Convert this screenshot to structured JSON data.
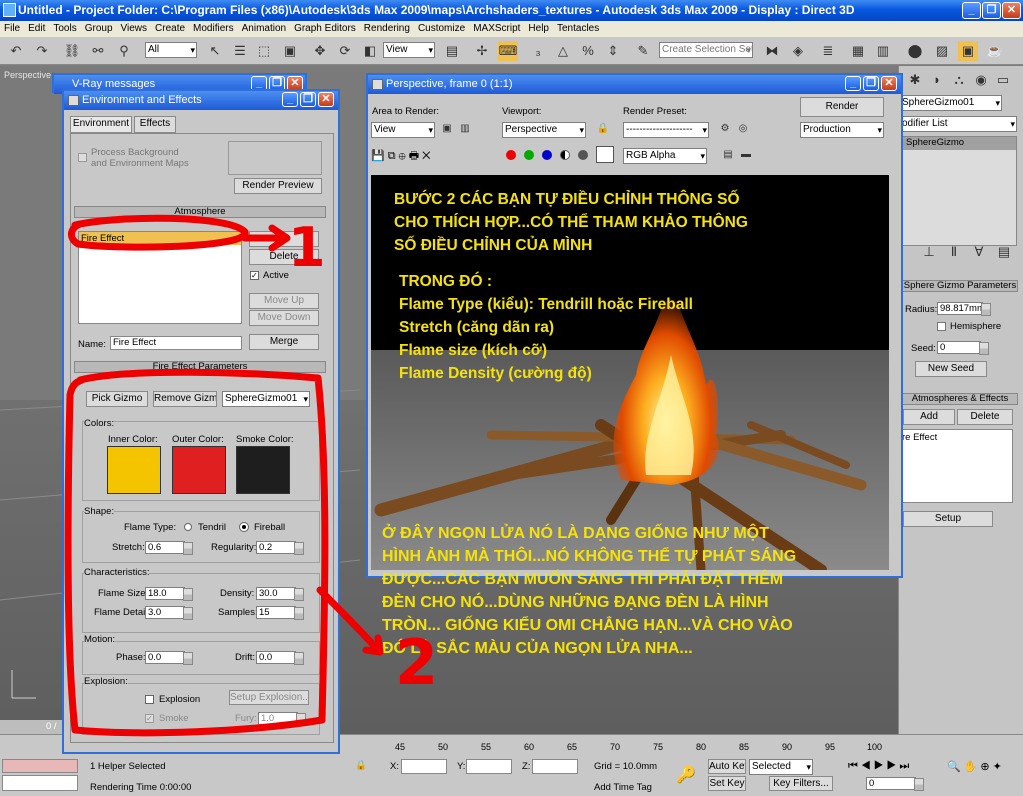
{
  "app": {
    "title": "Untitled    - Project Folder: C:\\Program Files (x86)\\Autodesk\\3ds Max 2009\\maps\\Archshaders_textures      - Autodesk 3ds Max  2009      - Display : Direct 3D"
  },
  "menu": [
    "File",
    "Edit",
    "Tools",
    "Group",
    "Views",
    "Create",
    "Modifiers",
    "Animation",
    "Graph Editors",
    "Rendering",
    "Customize",
    "MAXScript",
    "Help",
    "Tentacles"
  ],
  "toolbar": {
    "filter": "All",
    "view": "View",
    "selection_set": "Create Selection Set"
  },
  "viewport": {
    "label": "Perspective"
  },
  "vray": {
    "title": "V-Ray messages"
  },
  "env": {
    "title": "Environment and Effects",
    "tabs": [
      "Environment",
      "Effects"
    ],
    "process_bg": "Process Background",
    "process_env": "and Environment Maps",
    "render_preview": "Render Preview",
    "atmosphere_header": "Atmosphere",
    "list_item": "Fire Effect",
    "delete": "Delete",
    "active": "Active",
    "move_up": "Move Up",
    "move_down": "Move Down",
    "name_label": "Name:",
    "name_value": "Fire Effect",
    "merge": "Merge",
    "params_header": "Fire Effect Parameters",
    "pick_gizmo": "Pick Gizmo",
    "remove_gizmo": "Remove Gizmo",
    "gizmo_select": "SphereGizmo01",
    "colors_label": "Colors:",
    "inner_color": "Inner Color:",
    "outer_color": "Outer Color:",
    "smoke_color": "Smoke Color:",
    "shape_label": "Shape:",
    "flame_type": "Flame Type:",
    "tendril": "Tendril",
    "fireball": "Fireball",
    "stretch": "Stretch:",
    "stretch_val": "0.6",
    "regularity": "Regularity:",
    "regularity_val": "0.2",
    "characteristics": "Characteristics:",
    "flame_size": "Flame Size:",
    "flame_size_val": "18.0",
    "density": "Density:",
    "density_val": "30.0",
    "flame_detail": "Flame Detail:",
    "flame_detail_val": "3.0",
    "samples": "Samples:",
    "samples_val": "15",
    "motion": "Motion:",
    "phase": "Phase:",
    "phase_val": "0.0",
    "drift": "Drift:",
    "drift_val": "0.0",
    "explosion_label": "Explosion:",
    "explosion": "Explosion",
    "setup_explosion": "Setup Explosion...",
    "smoke": "Smoke",
    "fury": "Fury:",
    "fury_val": "1.0"
  },
  "colors": {
    "inner": "#f5c400",
    "outer": "#e02020",
    "smoke": "#1e1e1e"
  },
  "frame": {
    "title": "Perspective, frame 0 (1:1)",
    "area_label": "Area to Render:",
    "area_value": "View",
    "viewport_label": "Viewport:",
    "viewport_value": "Perspective",
    "preset_label": "Render Preset:",
    "preset_value": "--------------------",
    "render": "Render",
    "production": "Production",
    "channel": "RGB Alpha"
  },
  "annotation": {
    "top": [
      "BƯỚC 2 CÁC BẠN TỰ ĐIỀU CHỈNH THÔNG SỐ",
      "CHO THÍCH HỢP...CÓ THỂ THAM KHẢO THÔNG",
      "SỐ ĐIỀU CHỈNH CỦA MÌNH"
    ],
    "list": [
      "TRONG ĐÓ :",
      "Flame Type (kiểu): Tendrill hoặc Fireball",
      "Stretch (căng dãn ra)",
      "Flame size (kích cỡ)",
      "Flame Density (cường độ)"
    ],
    "bottom": [
      "Ở ĐÂY NGỌN LỬA NÓ LÀ DẠNG GIỐNG NHƯ MỘT",
      "HÌNH ẢNH MÀ THÔI...NÓ KHÔNG THỂ TỰ PHÁT SÁNG",
      "ĐƯỢC...CÁC BẠN MUỐN SÁNG THÌ PHẢI ĐẶT THÊM",
      "ĐÈN CHO NÓ...DÙNG NHỮNG ĐẠNG ĐÈN LÀ HÌNH",
      "TRÒN... GIỐNG KIỂU OMI CHẲNG HẠN...VÀ CHO VÀO",
      "ĐÓ LÀ SẮC MÀU CỦA NGỌN LỬA NHA..."
    ],
    "mark1": "1",
    "mark2": "2"
  },
  "cmd": {
    "object": "SphereGizmo01",
    "modifier_list": "odifier List",
    "stack_item": "SphereGizmo",
    "gizmo_params": "Sphere Gizmo Parameters",
    "radius": "Radius:",
    "radius_val": "98.817mm",
    "hemisphere": "Hemisphere",
    "seed": "Seed:",
    "seed_val": "0",
    "new_seed": "New Seed",
    "atmos": "Atmospheres & Effects",
    "add": "Add",
    "delete": "Delete",
    "effect_item": "re Effect",
    "setup": "Setup"
  },
  "timeline": {
    "ticks": [
      "45",
      "50",
      "55",
      "60",
      "65",
      "70",
      "75",
      "80",
      "85",
      "90",
      "95",
      "100"
    ],
    "frame": "0 /"
  },
  "status": {
    "helper": "1 Helper Selected",
    "rendering_time": "Rendering Time  0:00:00",
    "x": "X:",
    "y": "Y:",
    "z": "Z:",
    "grid": "Grid = 10.0mm",
    "add_time_tag": "Add Time Tag",
    "auto_key": "Auto Key",
    "set_key": "Set Key",
    "selected": "Selected",
    "key_filters": "Key Filters...",
    "frame_field": "0"
  }
}
